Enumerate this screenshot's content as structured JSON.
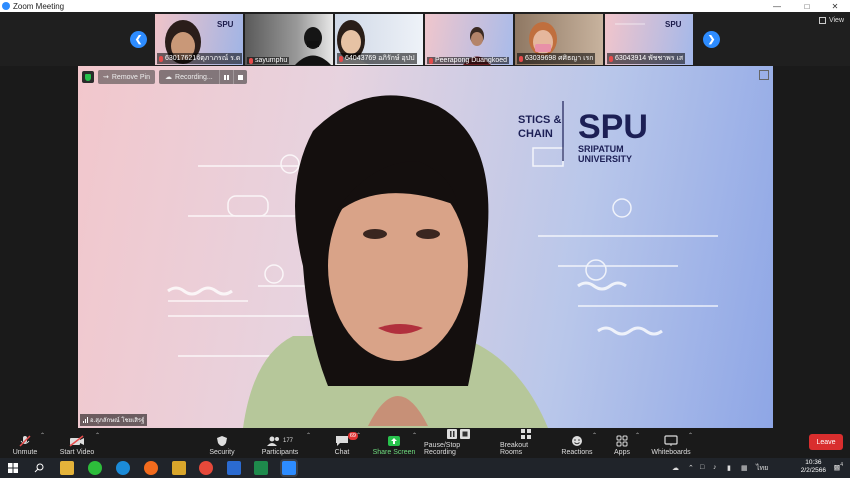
{
  "window": {
    "title": "Zoom Meeting"
  },
  "filmstrip": {
    "participants": [
      {
        "name": "63017621จิตุภาภรณ์ ร.ด"
      },
      {
        "name": "sayumphu"
      },
      {
        "name": "64043769 อภิรักษ์ อุปป"
      },
      {
        "name": "Peerapong Duangkoed"
      },
      {
        "name": "63039698 ศศิธญา เรก"
      },
      {
        "name": "63043914 พัชชาพร เส"
      }
    ],
    "view_label": "View"
  },
  "main_video": {
    "remove_pin": "Remove Pin",
    "recording": "Recording...",
    "speaker_name": "อ.สุภลักษณ์ โชยเสิรฐ์",
    "background": {
      "brand": "SPU",
      "brand_sub1": "SRIPATUM",
      "brand_sub2": "UNIVERSITY",
      "dept_line1": "STICS &",
      "dept_line2": "CHAIN"
    }
  },
  "toolbar": {
    "unmute": "Unmute",
    "start_video": "Start Video",
    "security": "Security",
    "participants": "Participants",
    "participants_count": "177",
    "chat": "Chat",
    "chat_badge": "69",
    "share_screen": "Share Screen",
    "pause_recording": "Pause/Stop Recording",
    "breakout_rooms": "Breakout Rooms",
    "reactions": "Reactions",
    "apps": "Apps",
    "whiteboards": "Whiteboards",
    "leave": "Leave"
  },
  "taskbar": {
    "lang": "ไทย",
    "time": "10:36",
    "date": "2/2/2566",
    "notify": "4"
  },
  "colors": {
    "accent": "#2d8cff",
    "leave": "#d92e2e",
    "share": "#27c24c"
  }
}
